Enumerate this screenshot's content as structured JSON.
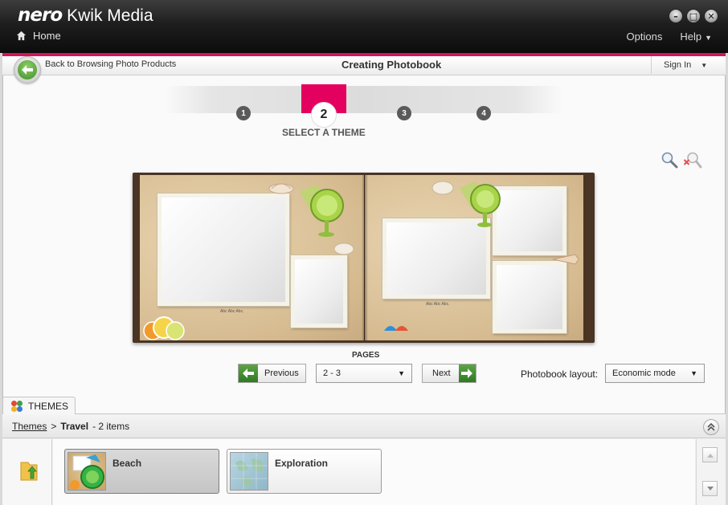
{
  "app": {
    "brand": "nero",
    "product": "Kwik Media",
    "window_controls": [
      "minimize-icon",
      "maximize-icon",
      "close-icon"
    ]
  },
  "nav": {
    "home_label": "Home",
    "options_label": "Options",
    "help_label": "Help"
  },
  "subheader": {
    "back_label": "Back to Browsing Photo Products",
    "title": "Creating Photobook",
    "sign_in_label": "Sign In"
  },
  "stepper": {
    "steps": [
      "1",
      "2",
      "3",
      "4"
    ],
    "active_step": 2,
    "active_label": "SELECT A THEME"
  },
  "book": {
    "left_caption": "Abc Abc Abc.",
    "right_caption": "Abc Abc Abc."
  },
  "pages_nav": {
    "label": "PAGES",
    "previous_label": "Previous",
    "next_label": "Next",
    "current_pages": "2 - 3"
  },
  "layout": {
    "label": "Photobook layout:",
    "value": "Economic mode"
  },
  "themes": {
    "tab_label": "THEMES",
    "breadcrumb_root": "Themes",
    "breadcrumb_separator": ">",
    "breadcrumb_current": "Travel",
    "item_count": "- 2 items",
    "items": [
      {
        "name": "Beach",
        "selected": true
      },
      {
        "name": "Exploration",
        "selected": false
      }
    ]
  },
  "colors": {
    "accent": "#d4145a",
    "step_active": "#e4005e",
    "arrow_green": "#3f8e2a"
  }
}
